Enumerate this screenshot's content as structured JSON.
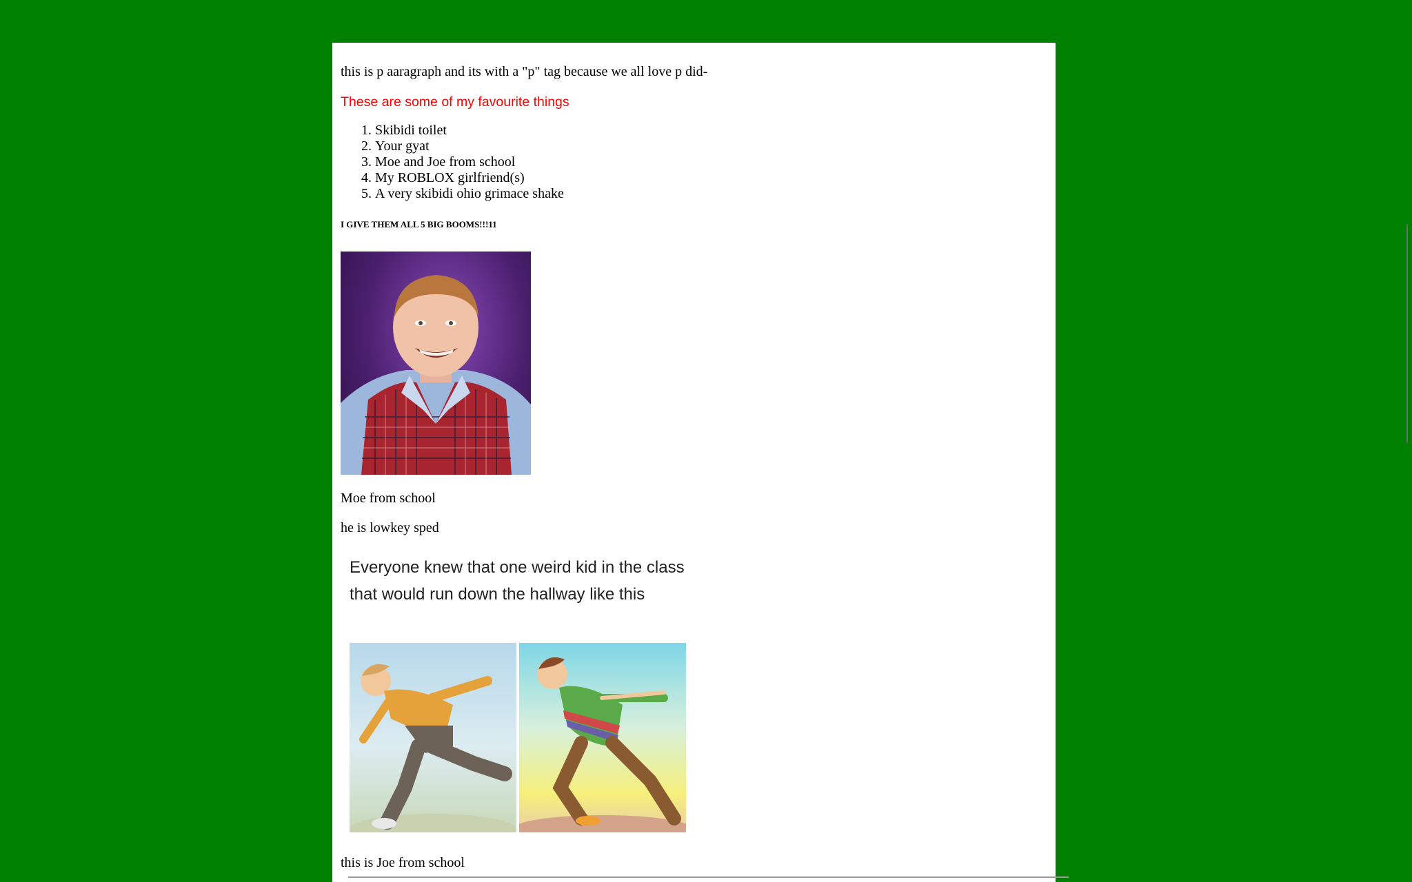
{
  "page": {
    "intro": "this is p aaragraph and its with a \"p\" tag because we all love p did-",
    "favourites_heading": "These are some of my favourite things",
    "favourites": [
      "Skibidi toilet",
      "Your gyat",
      "Moe and Joe from school",
      "My ROBLOX girlfriend(s)",
      "A very skibidi ohio grimace shake"
    ],
    "booms_heading": "I GIVE THEM ALL 5 BIG BOOMS!!!11",
    "moe_caption": "Moe from school",
    "moe_subcaption": "he is lowkey sped",
    "meme_text": "Everyone knew that one weird kid in the class that would run down the hallway like this",
    "joe_caption": "this is Joe from school"
  },
  "colors": {
    "background": "#008000",
    "content": "#ffffff",
    "heading_accent": "#ff0000"
  }
}
